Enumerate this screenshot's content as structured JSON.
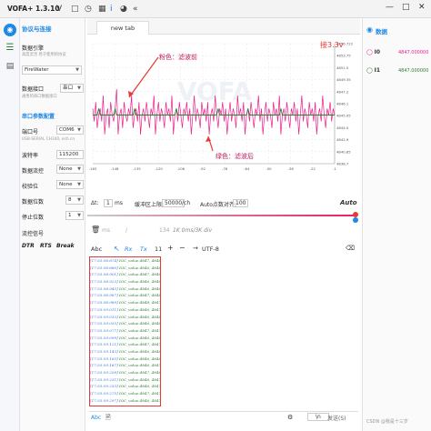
{
  "app": {
    "title": "VOFA+ 1.3.10",
    "icons": [
      "v-logo-icon",
      "save-icon",
      "clock-icon",
      "grid-icon",
      "eye-icon",
      "info-icon",
      "chevron-left-double-icon"
    ],
    "window_buttons": [
      "—",
      "□",
      "✕"
    ]
  },
  "left_nav": [
    "connect-icon",
    "menu-icon",
    "data-icon"
  ],
  "connection": {
    "header": "协议与连接",
    "engine_label": "数据引擎",
    "engine_hint": "高度灵活 易于使用的协议",
    "engine_value": "FireWater",
    "interface_label": "数据接口",
    "interface_hint": "通用的串口数据接口",
    "interface_value": "串口",
    "serial_header": "串口参数配置",
    "port_label": "端口号",
    "port_value": "COM6",
    "port_hint": "USB-SERIAL CH340, ech.cn",
    "baud_label": "波特率",
    "baud_value": "115200",
    "flow_label": "数据流控",
    "flow_value": "None",
    "parity_label": "校验位",
    "parity_value": "None",
    "databits_label": "数据位数",
    "databits_value": "8",
    "stopbits_label": "停止位数",
    "stopbits_value": "1",
    "flowsig_label": "流控信号",
    "signals": [
      "DTR",
      "RTS",
      "Break"
    ]
  },
  "tab": {
    "label": "new tab"
  },
  "chart_data": {
    "type": "line",
    "title": "",
    "xlabel": "",
    "ylabel": "",
    "x": [
      -163,
      -162,
      -161,
      -160,
      -159,
      -158,
      -157,
      -156,
      -155,
      -154,
      -153,
      -152,
      -151,
      -150,
      -149,
      -148,
      -147,
      -146,
      -145,
      -144,
      -143,
      -142,
      -141,
      -140,
      -139,
      -138,
      -137,
      -136,
      -135,
      -134,
      -133,
      -132,
      -131,
      -130,
      -129,
      -128,
      -127,
      -126,
      -125,
      -124,
      -123,
      -122,
      -121,
      -120,
      -119,
      -118,
      -117,
      -116,
      -115,
      -114,
      -113,
      -112,
      -111,
      -110,
      -109,
      -108,
      -107,
      -106,
      -105,
      -104,
      -103,
      -102,
      -101,
      -100,
      -99,
      -98,
      -97,
      -96,
      -95,
      -94,
      -93,
      -92,
      -91,
      -90,
      -89,
      -88,
      -87,
      -86,
      -85,
      -84,
      -83,
      -82,
      -81,
      -80,
      -79,
      -78,
      -77,
      -76,
      -75,
      -74,
      -73,
      -72,
      -71,
      -70,
      -69,
      -68,
      -67,
      -66,
      -65,
      -64,
      -63,
      -62,
      -61,
      -60,
      -59,
      -58,
      -57,
      -56,
      -55,
      -54,
      -53,
      -52,
      -51,
      -50,
      -49,
      -48,
      -47,
      -46,
      -45,
      -44,
      -43,
      -42,
      -41,
      -40,
      -39,
      -38,
      -37,
      -36,
      -35,
      -34,
      -33,
      -32,
      -31,
      -30,
      -29,
      -28,
      -27,
      -26,
      -25,
      -24,
      -23,
      -22,
      -21,
      -20,
      -19,
      -18,
      -17,
      -16,
      -15,
      -14,
      -13,
      -12,
      -11,
      -10,
      -9,
      -8,
      -7,
      -6,
      -5,
      -4,
      -3,
      -2,
      -1
    ],
    "series": [
      {
        "name": "I0",
        "color": "#e91e8c",
        "values": [
          4847,
          4845,
          4848,
          4844,
          4846,
          4847,
          4845,
          4849,
          4843,
          4846,
          4847,
          4844,
          4848,
          4846,
          4845,
          4847,
          4850,
          4843,
          4846,
          4847,
          4844,
          4848,
          4846,
          4845,
          4847,
          4846,
          4849,
          4844,
          4846,
          4847,
          4845,
          4848,
          4843,
          4846,
          4847,
          4845,
          4848,
          4846,
          4844,
          4847,
          4846,
          4849,
          4843,
          4846,
          4848,
          4845,
          4847,
          4846,
          4844,
          4848,
          4846,
          4847,
          4845,
          4849,
          4843,
          4846,
          4847,
          4845,
          4848,
          4846,
          4844,
          4847,
          4846,
          4848,
          4845,
          4847,
          4843,
          4846,
          4849,
          4845,
          4847,
          4846,
          4844,
          4848,
          4846,
          4847,
          4845,
          4848,
          4843,
          4846,
          4847,
          4845,
          4849,
          4846,
          4844,
          4847,
          4846,
          4848,
          4845,
          4847,
          4843,
          4846,
          4848,
          4845,
          4847,
          4846,
          4844,
          4849,
          4846,
          4847,
          4845,
          4848,
          4843,
          4846,
          4847,
          4845,
          4848,
          4846,
          4844,
          4847,
          4846,
          4849,
          4845,
          4847,
          4843,
          4846,
          4848,
          4845,
          4847,
          4846,
          4844,
          4848,
          4846,
          4847,
          4845,
          4849,
          4843,
          4846,
          4847,
          4845,
          4848,
          4846,
          4844,
          4847,
          4846,
          4848,
          4845,
          4847,
          4843,
          4846,
          4849,
          4845,
          4847,
          4846,
          4844,
          4848,
          4846,
          4847,
          4845,
          4848,
          4843,
          4846,
          4847,
          4845,
          4849,
          4846,
          4844,
          4847,
          4846,
          4848,
          4845,
          4847,
          4846
        ]
      },
      {
        "name": "I1",
        "color": "#2e7d32",
        "values": [
          4846,
          4846,
          4846,
          4846,
          4847,
          4846,
          4846,
          4846,
          4846,
          4846,
          4846,
          4846,
          4846,
          4846,
          4846,
          4847,
          4846,
          4846,
          4846,
          4846,
          4846,
          4846,
          4846,
          4846,
          4846,
          4846,
          4846,
          4846,
          4847,
          4846,
          4846,
          4846,
          4846,
          4846,
          4846,
          4846,
          4846,
          4846,
          4846,
          4846,
          4846,
          4846,
          4846,
          4846,
          4846,
          4846,
          4846,
          4846,
          4846,
          4846,
          4846,
          4846,
          4846,
          4846,
          4846,
          4846,
          4847,
          4846,
          4846,
          4846,
          4846,
          4846,
          4846,
          4846,
          4846,
          4846,
          4846,
          4846,
          4846,
          4846,
          4846,
          4846,
          4846,
          4846,
          4846,
          4846,
          4846,
          4846,
          4846,
          4846,
          4846,
          4846,
          4846,
          4846,
          4847,
          4846,
          4846,
          4846,
          4846,
          4846,
          4846,
          4846,
          4846,
          4846,
          4846,
          4846,
          4846,
          4846,
          4846,
          4846,
          4846,
          4846,
          4846,
          4846,
          4847,
          4846,
          4846,
          4846,
          4846,
          4846,
          4846,
          4846,
          4846,
          4846,
          4846,
          4846,
          4846,
          4846,
          4846,
          4846,
          4846,
          4846,
          4846,
          4846,
          4846,
          4846,
          4847,
          4846,
          4846,
          4846,
          4846,
          4846,
          4846,
          4846,
          4846,
          4846,
          4846,
          4846,
          4846,
          4846,
          4846,
          4846,
          4846,
          4846,
          4846,
          4846,
          4846,
          4846,
          4846,
          4846,
          4846,
          4846,
          4846,
          4846,
          4846,
          4846,
          4846,
          4846,
          4846,
          4846,
          4846,
          4846,
          4846
        ]
      }
    ],
    "xticks": [
      "-163",
      "-148",
      "-135",
      "-120",
      "-106",
      "-92",
      "-78",
      "-64",
      "-50",
      "-36",
      "-22",
      "-1"
    ],
    "yticks": [
      "4856.722",
      "4853.75",
      "4851.5",
      "4849.35",
      "4847.2",
      "4846.1",
      "4845.05",
      "4844.0",
      "4842.9",
      "4840.85",
      "4838.7"
    ],
    "ylim": [
      4838.5,
      4857
    ],
    "annotations": {
      "pink": "粉色：滤波前",
      "green": "绿色：滤波后",
      "corner": "接3.3v"
    }
  },
  "controls": {
    "dt_label": "Δt:",
    "dt_value": "1",
    "dt_unit": "ms",
    "buffer_label": "缓冲区上限:",
    "buffer_value": "50000",
    "buffer_unit": "/ch",
    "auto_label": "Auto点数对齐:",
    "auto_value": "100",
    "auto_flag": "Auto"
  },
  "console_top": {
    "ms1": "ms",
    "slash1": "/",
    "val1": "134",
    "tail": "1K 0ms/3K div"
  },
  "console_toolbar": {
    "abc": "Abc",
    "rx": "Rx",
    "tx": "Tx",
    "count": "11",
    "encoding": "UTF-8"
  },
  "log": [
    {
      "t": "[17:55:58.874]",
      "v": "IOC_value:4847, 4846"
    },
    {
      "t": "[17:55:58.880]",
      "v": "IOC_value:4846, 4846"
    },
    {
      "t": "[17:55:58.901]",
      "v": "IOC_value:4847, 4846"
    },
    {
      "t": "[17:55:58.923]",
      "v": "IOC_value:4846, 4846"
    },
    {
      "t": "[17:55:58.945]",
      "v": "IOC_value:4846, 4846"
    },
    {
      "t": "[17:55:58.967]",
      "v": "IOC_value:4847, 4846"
    },
    {
      "t": "[17:55:58.989]",
      "v": "IOC_value:4848, 4847"
    },
    {
      "t": "[17:55:59.011]",
      "v": "IOC_value:4846, 4847"
    },
    {
      "t": "[17:55:59.033]",
      "v": "IOC_value:4846, 4846"
    },
    {
      "t": "[17:55:59.055]",
      "v": "IOC_value:4846, 4846"
    },
    {
      "t": "[17:55:59.077]",
      "v": "IOC_value:4847, 4847"
    },
    {
      "t": "[17:55:59.099]",
      "v": "IOC_value:4846, 4846"
    },
    {
      "t": "[17:55:59.121]",
      "v": "IOC_value:4847, 4847"
    },
    {
      "t": "[17:55:59.143]",
      "v": "IOC_value:4846, 4846"
    },
    {
      "t": "[17:55:59.165]",
      "v": "IOC_value:4846, 4846"
    },
    {
      "t": "[17:55:59.187]",
      "v": "IOC_value:4846, 4847"
    },
    {
      "t": "[17:55:59.209]",
      "v": "IOC_value:4847, 4846"
    },
    {
      "t": "[17:55:59.231]",
      "v": "IOC_value:4846, 4847"
    },
    {
      "t": "[17:55:59.253]",
      "v": "IOC_value:4846, 4847"
    },
    {
      "t": "[17:55:59.275]",
      "v": "IOC_value:4847, 4847"
    },
    {
      "t": "[17:55:59.297]",
      "v": "IOC_value:4846, 4847"
    }
  ],
  "send_bar": {
    "abc": "Abc",
    "newline": "\\n",
    "send_label": "发送(S)"
  },
  "right_panel": {
    "header": "数据",
    "channels": [
      {
        "name": "I0",
        "value": "4847.000000",
        "color": "#e91e8c"
      },
      {
        "name": "I1",
        "value": "4847.000000",
        "color": "#2e7d32"
      }
    ]
  },
  "watermark": "CSDN @我是十三岁"
}
